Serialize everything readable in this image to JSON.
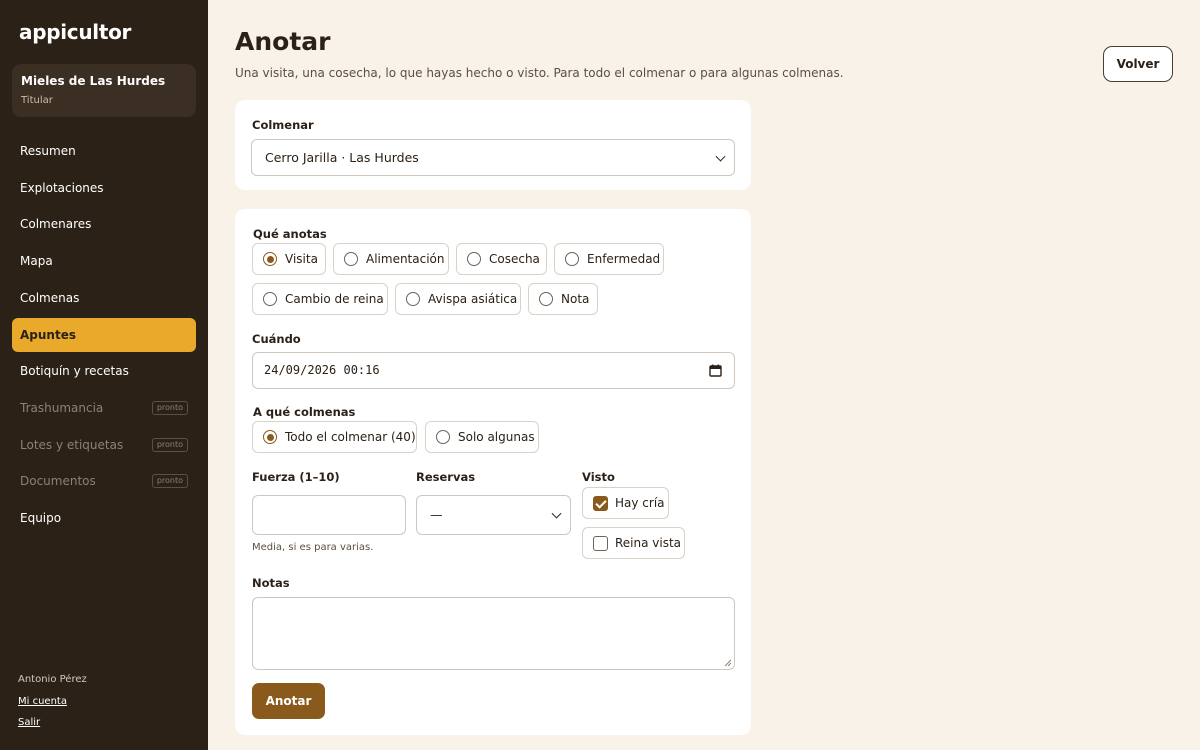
{
  "brand": "appicultor",
  "org": {
    "name": "Mieles de Las Hurdes",
    "role": "Titular"
  },
  "nav": [
    {
      "label": "Resumen"
    },
    {
      "label": "Explotaciones"
    },
    {
      "label": "Colmenares"
    },
    {
      "label": "Mapa"
    },
    {
      "label": "Colmenas"
    },
    {
      "label": "Apuntes",
      "active": true
    },
    {
      "label": "Botiquín y recetas"
    },
    {
      "label": "Trashumancia",
      "badge": "pronto"
    },
    {
      "label": "Lotes y etiquetas",
      "badge": "pronto"
    },
    {
      "label": "Documentos",
      "badge": "pronto"
    },
    {
      "label": "Equipo"
    }
  ],
  "user": {
    "name": "Antonio Pérez",
    "account_link": "Mi cuenta",
    "logout_link": "Salir"
  },
  "page": {
    "title": "Anotar",
    "subtitle": "Una visita, una cosecha, lo que hayas hecho o visto. Para todo el colmenar o para algunas colmenas.",
    "back_button": "Volver"
  },
  "form": {
    "colmenar_label": "Colmenar",
    "colmenar_value": "Cerro Jarilla · Las Hurdes",
    "type_label": "Qué anotas",
    "types": [
      {
        "label": "Visita",
        "selected": true
      },
      {
        "label": "Alimentación",
        "selected": false
      },
      {
        "label": "Cosecha",
        "selected": false
      },
      {
        "label": "Enfermedad",
        "selected": false
      },
      {
        "label": "Cambio de reina",
        "selected": false
      },
      {
        "label": "Avispa asiática",
        "selected": false
      },
      {
        "label": "Nota",
        "selected": false
      }
    ],
    "when_label": "Cuándo",
    "when_value": "24/09/2026 00:16",
    "scope_label": "A qué colmenas",
    "scope_options": [
      {
        "label": "Todo el colmenar (40)",
        "selected": true
      },
      {
        "label": "Solo algunas",
        "selected": false
      }
    ],
    "strength_label": "Fuerza (1–10)",
    "strength_value": "",
    "strength_hint": "Media, si es para varias.",
    "reserves_label": "Reservas",
    "reserves_value": "—",
    "seen_label": "Visto",
    "seen_options": [
      {
        "label": "Hay cría",
        "checked": true
      },
      {
        "label": "Reina vista",
        "checked": false
      }
    ],
    "notes_label": "Notas",
    "notes_value": "",
    "submit_label": "Anotar"
  },
  "colors": {
    "sidebar_bg": "#2c2116",
    "accent": "#e9a92a",
    "primary_button": "#8a5a1d",
    "page_bg": "#f8f2e8"
  }
}
